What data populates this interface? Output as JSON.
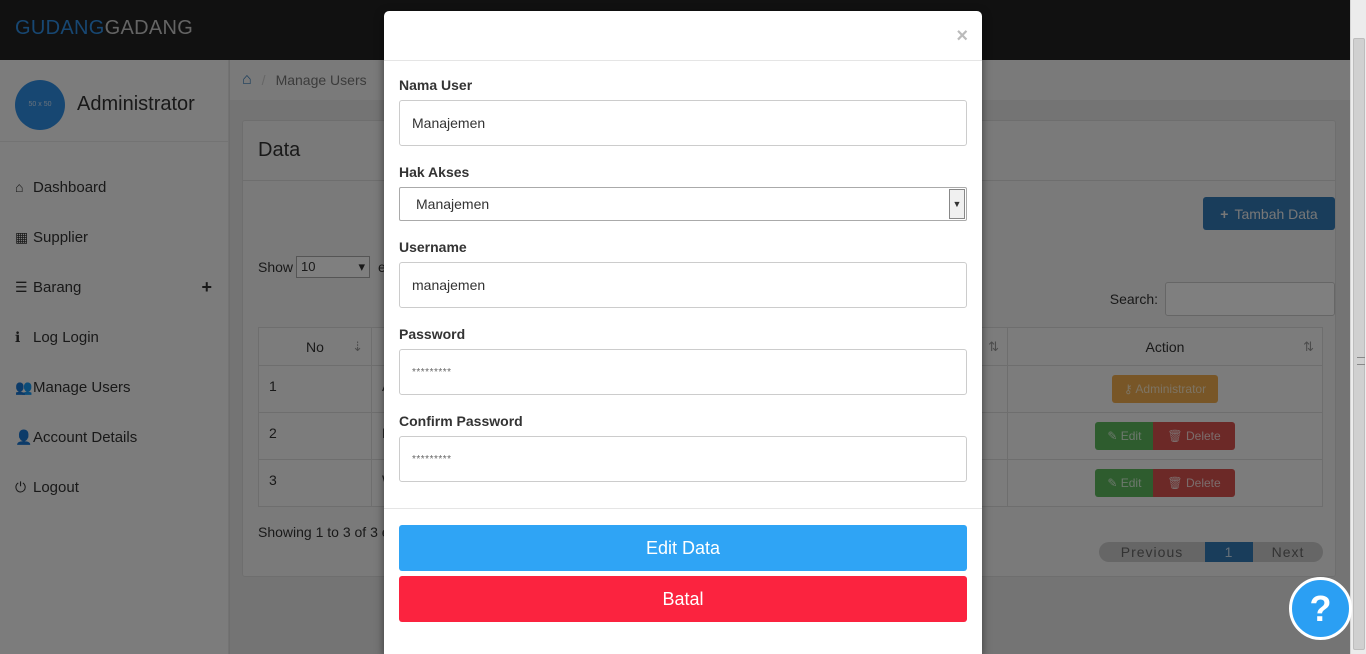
{
  "brand": {
    "part1": "GUDANG",
    "part2": "GADANG"
  },
  "profile": {
    "avatar_text": "50 x 50",
    "name": "Administrator"
  },
  "menu": [
    {
      "icon": "home-icon",
      "glyph": "⌂",
      "label": "Dashboard"
    },
    {
      "icon": "calendar-icon",
      "glyph": "▦",
      "label": "Supplier"
    },
    {
      "icon": "list-icon",
      "glyph": "☰",
      "label": "Barang",
      "extra": "+"
    },
    {
      "icon": "info-icon",
      "glyph": "ℹ",
      "label": "Log Login"
    },
    {
      "icon": "users-icon",
      "glyph": "👥",
      "label": "Manage Users"
    },
    {
      "icon": "user-icon",
      "glyph": "👤",
      "label": "Account Details"
    },
    {
      "icon": "power-icon",
      "glyph": "⏻",
      "label": "Logout"
    }
  ],
  "breadcrumb": {
    "current": "Manage Users"
  },
  "panel": {
    "title": "Data",
    "add_button": "Tambah Data",
    "show_label": "Show",
    "show_value": "10",
    "show_suffix": "e",
    "search_label": "Search:",
    "columns": {
      "no": "No",
      "action": "Action"
    },
    "rows": [
      {
        "no": "1",
        "col2": "A",
        "actions": [
          "Administrator"
        ]
      },
      {
        "no": "2",
        "col2": "M",
        "actions": [
          "Edit",
          "Delete"
        ]
      },
      {
        "no": "3",
        "col2": "W",
        "actions": [
          "Edit",
          "Delete"
        ]
      }
    ],
    "showing": "Showing 1 to 3 of 3 e",
    "pager": {
      "prev": "Previous",
      "current": "1",
      "next": "Next"
    }
  },
  "modal": {
    "close": "×",
    "fields": {
      "nama_label": "Nama User",
      "nama_value": "Manajemen",
      "hak_label": "Hak Akses",
      "hak_value": "Manajemen",
      "username_label": "Username",
      "username_value": "manajemen",
      "password_label": "Password",
      "password_value": "*********",
      "confirm_label": "Confirm Password",
      "confirm_value": "*********"
    },
    "edit_button": "Edit Data",
    "cancel_button": "Batal"
  },
  "help": {
    "label": "?"
  },
  "colors": {
    "primary": "#337ab7",
    "edit_data": "#2fa4f5",
    "batal": "#fb233f",
    "brand_blue": "#2f8ee5"
  }
}
